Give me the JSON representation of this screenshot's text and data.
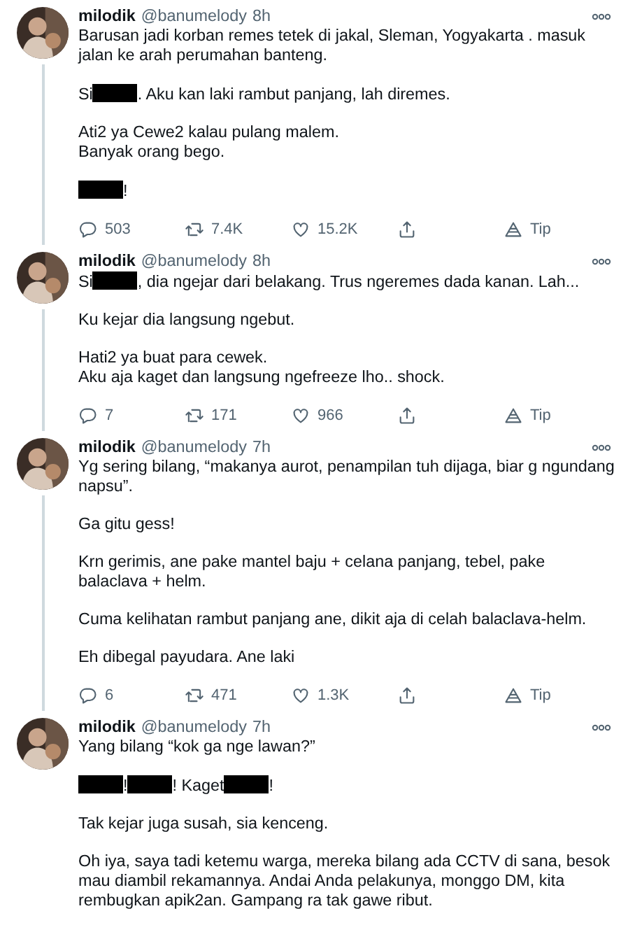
{
  "tweets": [
    {
      "name": "milodik",
      "handle": "@banumelody",
      "time": "8h",
      "thread_line": true,
      "paragraphs": [
        [
          [
            {
              "kind": "text",
              "text": "Barusan jadi korban remes tetek di jakal, Sleman, Yogyakarta . masuk jalan ke arah perumahan banteng."
            }
          ]
        ],
        [
          [
            {
              "kind": "text",
              "text": "Si"
            },
            {
              "kind": "redacted"
            },
            {
              "kind": "text",
              "text": ". Aku kan laki rambut panjang, lah diremes."
            }
          ]
        ],
        [
          [
            {
              "kind": "text",
              "text": "Ati2 ya Cewe2 kalau pulang malem."
            }
          ],
          [
            {
              "kind": "text",
              "text": "Banyak orang bego."
            }
          ]
        ],
        [
          [
            {
              "kind": "redacted"
            },
            {
              "kind": "text",
              "text": "!"
            }
          ]
        ]
      ],
      "replies": "503",
      "retweets": "7.4K",
      "likes": "15.2K",
      "tip": "Tip"
    },
    {
      "name": "milodik",
      "handle": "@banumelody",
      "time": "8h",
      "thread_line": true,
      "paragraphs": [
        [
          [
            {
              "kind": "text",
              "text": "Si"
            },
            {
              "kind": "redacted"
            },
            {
              "kind": "text",
              "text": ", dia ngejar dari belakang. Trus ngeremes dada kanan. Lah..."
            }
          ]
        ],
        [
          [
            {
              "kind": "text",
              "text": "Ku kejar dia langsung ngebut."
            }
          ]
        ],
        [
          [
            {
              "kind": "text",
              "text": "Hati2 ya buat para cewek."
            }
          ],
          [
            {
              "kind": "text",
              "text": "Aku aja kaget dan langsung ngefreeze lho.. shock."
            }
          ]
        ]
      ],
      "replies": "7",
      "retweets": "171",
      "likes": "966",
      "tip": "Tip"
    },
    {
      "name": "milodik",
      "handle": "@banumelody",
      "time": "7h",
      "thread_line": true,
      "paragraphs": [
        [
          [
            {
              "kind": "text",
              "text": "Yg sering bilang, “makanya aurot, penampilan tuh dijaga, biar g ngundang napsu”."
            }
          ]
        ],
        [
          [
            {
              "kind": "text",
              "text": "Ga gitu gess!"
            }
          ]
        ],
        [
          [
            {
              "kind": "text",
              "text": "Krn gerimis, ane pake mantel baju + celana panjang, tebel, pake balaclava + helm."
            }
          ]
        ],
        [
          [
            {
              "kind": "text",
              "text": "Cuma kelihatan rambut panjang ane, dikit aja di celah balaclava-helm."
            }
          ]
        ],
        [
          [
            {
              "kind": "text",
              "text": "Eh dibegal payudara. Ane laki"
            }
          ]
        ]
      ],
      "replies": "6",
      "retweets": "471",
      "likes": "1.3K",
      "tip": "Tip"
    },
    {
      "name": "milodik",
      "handle": "@banumelody",
      "time": "7h",
      "thread_line": false,
      "paragraphs": [
        [
          [
            {
              "kind": "text",
              "text": "Yang bilang “kok ga nge lawan?”"
            }
          ]
        ],
        [
          [
            {
              "kind": "redacted"
            },
            {
              "kind": "text",
              "text": "!"
            },
            {
              "kind": "redacted"
            },
            {
              "kind": "text",
              "text": "! Kaget"
            },
            {
              "kind": "redacted"
            },
            {
              "kind": "text",
              "text": "!"
            }
          ]
        ],
        [
          [
            {
              "kind": "text",
              "text": "Tak kejar juga susah, sia kenceng."
            }
          ]
        ],
        [
          [
            {
              "kind": "text",
              "text": "Oh iya, saya tadi ketemu warga, mereka bilang ada CCTV di sana, besok mau diambil rekamannya. Andai Anda pelakunya, monggo DM, kita rembugkan apik2an. Gampang ra tak gawe ribut."
            }
          ]
        ]
      ]
    }
  ]
}
